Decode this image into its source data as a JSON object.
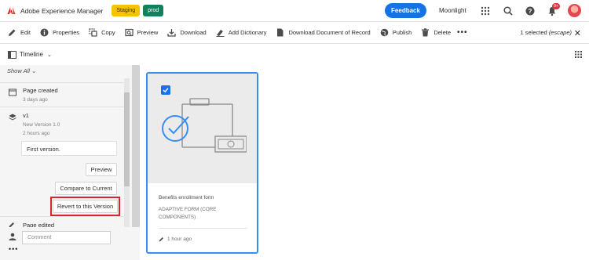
{
  "header": {
    "brand": "Adobe Experience Manager",
    "badge_staging": "Staging",
    "badge_prod": "prod",
    "feedback_label": "Feedback",
    "user_name": "Moonlight",
    "notification_count": "9+"
  },
  "actions": {
    "edit": "Edit",
    "properties": "Properties",
    "copy": "Copy",
    "preview": "Preview",
    "download": "Download",
    "add_dictionary": "Add Dictionary",
    "download_record": "Download Document of Record",
    "publish": "Publish",
    "delete": "Delete",
    "more": "•••",
    "selected": "1 selected",
    "escape": "(escape)",
    "close": "✕"
  },
  "timeline": {
    "label": "Timeline",
    "show_all": "Show All",
    "entries": [
      {
        "title": "Page created",
        "sub": "3 days ago"
      },
      {
        "title": "v1",
        "sub1": "New Version 1.0",
        "sub2": "2 hours ago",
        "comment": "First version."
      },
      {
        "title": "Page edited"
      }
    ],
    "buttons": {
      "preview": "Preview",
      "compare": "Compare to Current",
      "revert": "Revert to this Version"
    },
    "comment_placeholder": "Comment"
  },
  "card": {
    "title": "Benefits enrollment form",
    "type": "ADAPTIVE FORM (CORE COMPONENTS)",
    "time": "1 hour ago"
  },
  "colors": {
    "accent": "#1473e6",
    "staging": "#f5c400",
    "prod": "#12805c",
    "highlight": "#d7262d"
  }
}
